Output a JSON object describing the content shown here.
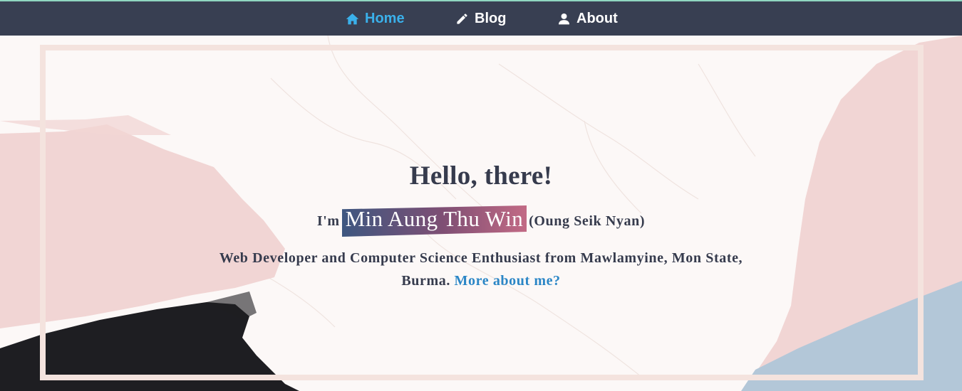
{
  "nav": {
    "items": [
      {
        "label": "Home",
        "icon": "home-icon",
        "active": true
      },
      {
        "label": "Blog",
        "icon": "pencil-icon",
        "active": false
      },
      {
        "label": "About",
        "icon": "user-icon",
        "active": false
      }
    ]
  },
  "hero": {
    "greeting": "Hello, there!",
    "intro_prefix": "I'm",
    "name": "Min Aung Thu Win",
    "alias": "(Oung Seik Nyan)",
    "description": "Web Developer and Computer Science Enthusiast from Mawlamyine, Mon State, Burma.",
    "more_link": "More about me?"
  },
  "colors": {
    "navbar": "#383f52",
    "nav_active": "#3ab0ea",
    "text": "#363b4d",
    "link": "#2b86c6",
    "frame": "#f4e3de",
    "pink_stroke": "#f1d5d4",
    "blue_stroke": "#b3c7d8",
    "black_stroke": "#1e1e22"
  }
}
